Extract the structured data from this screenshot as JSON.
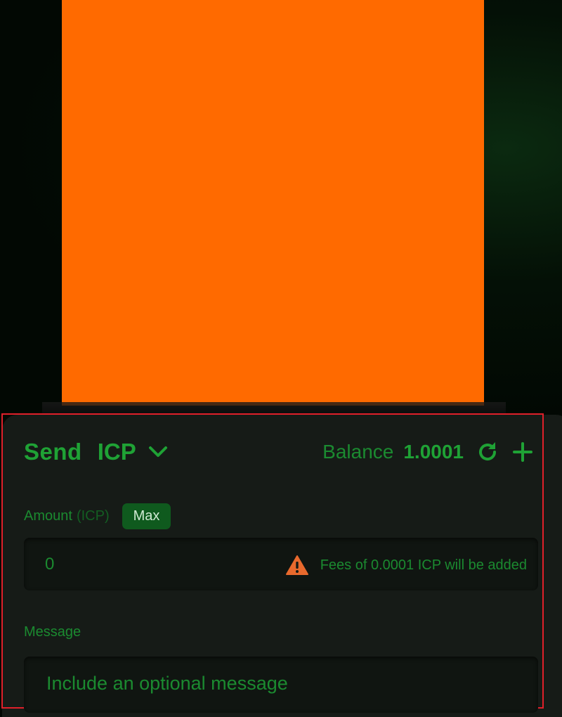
{
  "header": {
    "title": "Send",
    "token": "ICP",
    "balance_label": "Balance",
    "balance_value": "1.0001"
  },
  "amount": {
    "label": "Amount",
    "unit": "(ICP)",
    "max_label": "Max",
    "value": "0",
    "fee_note": "Fees of 0.0001 ICP will be added"
  },
  "message": {
    "label": "Message",
    "placeholder": "Include an optional message"
  },
  "icons": {
    "chevron": "chevron-down-icon",
    "refresh": "refresh-icon",
    "add": "plus-icon",
    "warning": "warning-icon"
  },
  "colors": {
    "accent": "#1fa235",
    "panel": "#161b17",
    "block": "#ff6a00",
    "warning": "#e8692d",
    "highlight": "#e0202a"
  }
}
